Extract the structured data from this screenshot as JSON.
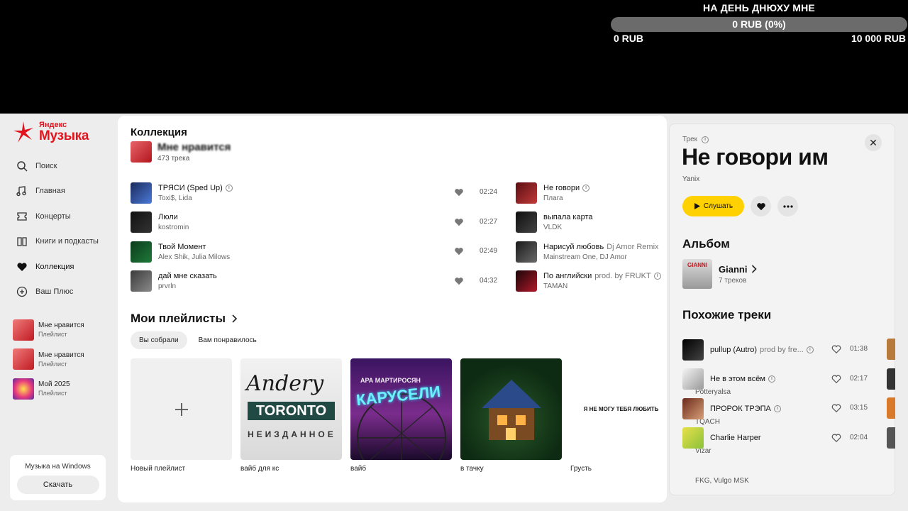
{
  "donation": {
    "title": "НА ДЕНЬ ДНЮХУ МНЕ",
    "progress_label": "0 RUB (0%)",
    "progress_fraction": 0,
    "min": "0 RUB",
    "max": "10 000 RUB"
  },
  "logo": {
    "small": "Яндекс",
    "big": "Музыка"
  },
  "nav": [
    {
      "label": "Поиск",
      "icon": "search-icon"
    },
    {
      "label": "Главная",
      "icon": "home-icon"
    },
    {
      "label": "Концерты",
      "icon": "ticket-icon"
    },
    {
      "label": "Книги и подкасты",
      "icon": "book-icon"
    },
    {
      "label": "Коллекция",
      "icon": "heart-icon"
    },
    {
      "label": "Ваш Плюс",
      "icon": "plus-icon"
    }
  ],
  "sidebar_playlists": [
    {
      "title": "Мне нравится",
      "subtitle": "Плейлист"
    },
    {
      "title": "Мне нравится",
      "subtitle": "Плейлист"
    },
    {
      "title": "Мой 2025",
      "subtitle": "Плейлист"
    }
  ],
  "windows_promo": {
    "text": "Музыка на Windows",
    "button": "Скачать"
  },
  "collection": {
    "header": "Коллекция",
    "likes_title": "Мне нравится",
    "likes_count": "473 трека",
    "tracks_left": [
      {
        "name": "ТРЯСИ (Sped Up)",
        "artist": "Toxi$, Lida",
        "duration": "02:24",
        "info": true
      },
      {
        "name": "Люли",
        "artist": "kostromin",
        "duration": "02:27"
      },
      {
        "name": "Твой Момент",
        "artist": "Alex Shik, Julia Milows",
        "duration": "02:49"
      },
      {
        "name": "дай мне сказать",
        "artist": "prvrln",
        "duration": "04:32"
      }
    ],
    "tracks_right": [
      {
        "name": "Не говори",
        "artist": "Плага",
        "info": true
      },
      {
        "name": "выпала карта",
        "artist": "VLDK"
      },
      {
        "name": "Нарисуй любовь",
        "sub": "Dj Amor Remix",
        "artist": "Mainstream One, DJ Amor"
      },
      {
        "name": "По английски",
        "sub": "prod. by FRUKT",
        "artist": "TAMAN",
        "info": true
      }
    ]
  },
  "playlists": {
    "title": "Мои плейлисты",
    "chips": [
      "Вы собрали",
      "Вам понравилось"
    ],
    "tiles": [
      {
        "label": "Новый плейлист"
      },
      {
        "label": "вайб для кс",
        "art_line1": "Andery",
        "art_line2": "TORONTO",
        "art_line3": "НЕИЗДАННОЕ"
      },
      {
        "label": "вайб",
        "art_line1": "АРА МАРТИРОСЯН",
        "art_line2": "КАРУСЕЛИ"
      },
      {
        "label": "в тачку"
      },
      {
        "label": "Грусть",
        "art_line1": "Я НЕ МОГУ ТЕБЯ ЛЮБИТЬ"
      }
    ]
  },
  "track_panel": {
    "kind": "Трек",
    "title": "Не говори им",
    "artist": "Yanix",
    "play_label": "Слушать",
    "album_header": "Альбом",
    "album_name": "Gianni",
    "album_count": "7 треков",
    "album_art_text": "GIANNI",
    "similar_header": "Похожие треки",
    "similar": [
      {
        "name": "pullup (Autro)",
        "sub": "prod by fre...",
        "artist": "Potteryalsa",
        "duration": "01:38",
        "info": true
      },
      {
        "name": "Не в этом всём",
        "artist": "TQACH",
        "duration": "02:17",
        "info": true
      },
      {
        "name": "ПРОРОК ТРЭПА",
        "artist": "Vizar",
        "duration": "03:15",
        "info": true
      },
      {
        "name": "Charlie Harper",
        "artist": "FKG, Vulgo MSK",
        "duration": "02:04"
      }
    ]
  },
  "colors": {
    "accent_yellow": "#ffd100",
    "brand_red": "#e2131c"
  }
}
